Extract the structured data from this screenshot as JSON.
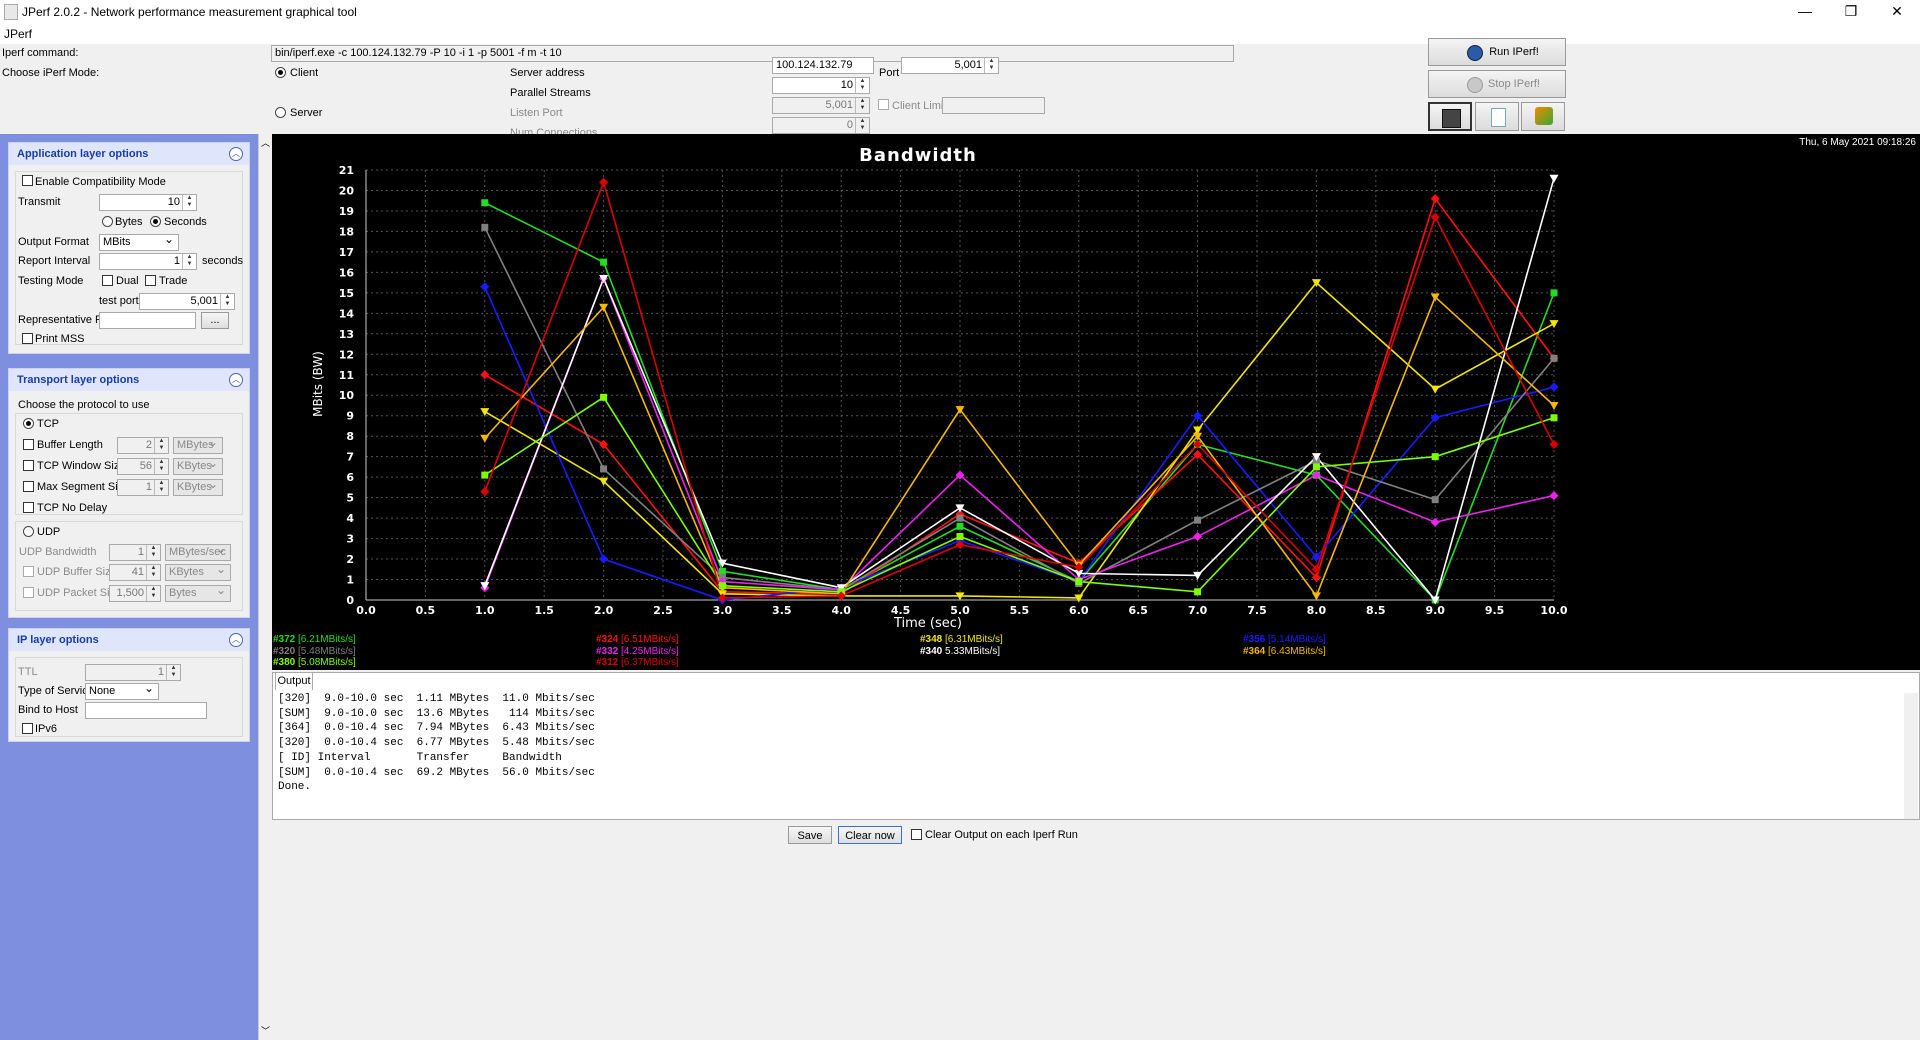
{
  "window": {
    "title": "JPerf 2.0.2 - Network performance measurement graphical tool",
    "menu": "JPerf",
    "controls": [
      "—",
      "❐",
      "✕"
    ]
  },
  "command": {
    "label": "Iperf command:",
    "value": "bin/iperf.exe -c 100.124.132.79 -P 10 -i 1 -p 5001 -f m -t 10"
  },
  "mode": {
    "label": "Choose iPerf Mode:",
    "client": "Client",
    "server": "Server",
    "selected": "Client",
    "server_address_label": "Server address",
    "server_address": "100.124.132.79",
    "port_label": "Port",
    "port": "5,001",
    "parallel_label": "Parallel Streams",
    "parallel": "10",
    "listen_port_label": "Listen Port",
    "listen_port": "5,001",
    "client_limit_label": "Client Limit",
    "client_limit": "",
    "num_conn_label": "Num Connections",
    "num_conn": "0"
  },
  "actions": {
    "run": "Run IPerf!",
    "stop": "Stop IPerf!"
  },
  "app_layer": {
    "title": "Application layer options",
    "compat": "Enable Compatibility Mode",
    "transmit_label": "Transmit",
    "transmit": "10",
    "bytes": "Bytes",
    "seconds": "Seconds",
    "output_format_label": "Output Format",
    "output_format": "MBits",
    "report_label": "Report Interval",
    "report": "1",
    "report_unit": "seconds",
    "testing_label": "Testing Mode",
    "dual": "Dual",
    "trade": "Trade",
    "test_port_label": "test port",
    "test_port": "5,001",
    "rep_file_label": "Representative File",
    "rep_file": "",
    "browse": "...",
    "print_mss": "Print MSS"
  },
  "transport": {
    "title": "Transport layer options",
    "choose": "Choose the protocol to use",
    "tcp": "TCP",
    "buffer_label": "Buffer Length",
    "buffer": "2",
    "buffer_unit": "MBytes",
    "window_label": "TCP Window Size",
    "window": "56",
    "window_unit": "KBytes",
    "mss_label": "Max Segment Size",
    "mss": "1",
    "mss_unit": "KBytes",
    "nodelay": "TCP No Delay",
    "udp": "UDP",
    "udp_bw_label": "UDP Bandwidth",
    "udp_bw": "1",
    "udp_bw_unit": "MBytes/sec",
    "udp_buf_label": "UDP Buffer Size",
    "udp_buf": "41",
    "udp_buf_unit": "KBytes",
    "udp_pkt_label": "UDP Packet Size",
    "udp_pkt": "1,500",
    "udp_pkt_unit": "Bytes"
  },
  "ip_layer": {
    "title": "IP layer options",
    "ttl_label": "TTL",
    "ttl": "1",
    "tos_label": "Type of Service",
    "tos": "None",
    "bind_label": "Bind to Host",
    "bind": "",
    "ipv6": "IPv6"
  },
  "timestamp": "Thu, 6 May 2021 09:18:26",
  "chart_data": {
    "type": "line",
    "title": "Bandwidth",
    "xlabel": "Time (sec)",
    "ylabel": "MBits (BW)",
    "xlim": [
      0,
      10
    ],
    "ylim": [
      0,
      21
    ],
    "x": [
      1,
      2,
      3,
      4,
      5,
      6,
      7,
      8,
      9,
      10
    ],
    "xticks": [
      "0.0",
      "0.5",
      "1.0",
      "1.5",
      "2.0",
      "2.5",
      "3.0",
      "3.5",
      "4.0",
      "4.5",
      "5.0",
      "5.5",
      "6.0",
      "6.5",
      "7.0",
      "7.5",
      "8.0",
      "8.5",
      "9.0",
      "9.5",
      "10.0"
    ],
    "yticks": [
      "0",
      "1",
      "2",
      "3",
      "4",
      "5",
      "6",
      "7",
      "8",
      "9",
      "10",
      "11",
      "12",
      "13",
      "14",
      "15",
      "16",
      "17",
      "18",
      "19",
      "20",
      "21"
    ],
    "grid": true,
    "background": "#000000",
    "series": [
      {
        "name": "#372",
        "color": "#22dd22",
        "marker": "square",
        "values": [
          19.4,
          16.5,
          1.4,
          0.5,
          3.6,
          0.9,
          7.6,
          6.1,
          0.0,
          15.0
        ]
      },
      {
        "name": "#324",
        "color": "#ff1010",
        "marker": "diamond",
        "values": [
          11.0,
          7.6,
          0.4,
          0.3,
          4.2,
          1.8,
          7.1,
          1.1,
          19.6,
          11.8
        ]
      },
      {
        "name": "#348",
        "color": "#f2e600",
        "marker": "triangle-down",
        "values": [
          9.2,
          5.8,
          0.3,
          0.2,
          0.2,
          0.1,
          8.3,
          15.5,
          10.3,
          13.5
        ]
      },
      {
        "name": "#356",
        "color": "#1a1aff",
        "marker": "diamond",
        "values": [
          15.3,
          2.0,
          0.0,
          0.6,
          2.9,
          0.9,
          9.0,
          2.1,
          8.9,
          10.4
        ]
      },
      {
        "name": "#320",
        "color": "#808080",
        "marker": "square",
        "values": [
          18.2,
          6.4,
          1.1,
          0.5,
          4.0,
          0.8,
          3.9,
          6.8,
          4.9,
          11.8
        ]
      },
      {
        "name": "#332",
        "color": "#ee22ee",
        "marker": "diamond",
        "values": [
          0.6,
          15.7,
          0.9,
          0.5,
          6.1,
          1.0,
          3.1,
          6.1,
          3.8,
          5.1
        ]
      },
      {
        "name": "#340",
        "color": "#ffffff",
        "marker": "triangle-down",
        "values": [
          0.7,
          15.7,
          1.8,
          0.6,
          4.5,
          1.3,
          1.2,
          7.0,
          0.0,
          20.6
        ]
      },
      {
        "name": "#364",
        "color": "#f5b800",
        "marker": "triangle-down",
        "values": [
          7.9,
          14.3,
          0.6,
          0.3,
          9.3,
          1.7,
          8.0,
          0.2,
          14.8,
          9.5
        ]
      },
      {
        "name": "#380",
        "color": "#7cff00",
        "marker": "square",
        "values": [
          6.1,
          9.9,
          0.7,
          0.4,
          3.1,
          0.9,
          0.4,
          6.5,
          7.0,
          8.9
        ]
      },
      {
        "name": "#312",
        "color": "#dd0000",
        "marker": "diamond",
        "values": [
          5.3,
          20.4,
          0.1,
          0.2,
          2.7,
          1.6,
          7.6,
          1.5,
          18.7,
          7.6
        ]
      }
    ]
  },
  "legend": [
    {
      "id": "#372",
      "value": "[6.21MBits/s]",
      "color": "#22dd22"
    },
    {
      "id": "#324",
      "value": "[6.51MBits/s]",
      "color": "#ff1010"
    },
    {
      "id": "#348",
      "value": "[6.31MBits/s]",
      "color": "#f2e600"
    },
    {
      "id": "#356",
      "value": "[5.14MBits/s]",
      "color": "#1a1aff"
    },
    {
      "id": "#320",
      "value": "[5.48MBits/s]",
      "color": "#808080"
    },
    {
      "id": "#332",
      "value": "[4.25MBits/s]",
      "color": "#ee22ee"
    },
    {
      "id": "#340",
      "value": "5.33MBits/s]",
      "color": "#ffffff"
    },
    {
      "id": "#364",
      "value": "[6.43MBits/s]",
      "color": "#f5b800"
    },
    {
      "id": "#380",
      "value": "[5.08MBits/s]",
      "color": "#7cff00"
    },
    {
      "id": "#312",
      "value": "[6.37MBits/s]",
      "color": "#dd0000"
    }
  ],
  "output": {
    "tab": "Output",
    "lines": [
      "[320]  9.0-10.0 sec  1.11 MBytes  11.0 Mbits/sec",
      "[SUM]  9.0-10.0 sec  13.6 MBytes   114 Mbits/sec",
      "[364]  0.0-10.4 sec  7.94 MBytes  6.43 Mbits/sec",
      "[320]  0.0-10.4 sec  6.77 MBytes  5.48 Mbits/sec",
      "[ ID] Interval       Transfer     Bandwidth",
      "[SUM]  0.0-10.4 sec  69.2 MBytes  56.0 Mbits/sec",
      "Done."
    ],
    "save": "Save",
    "clear": "Clear now",
    "clear_each": "Clear Output on each Iperf Run"
  }
}
